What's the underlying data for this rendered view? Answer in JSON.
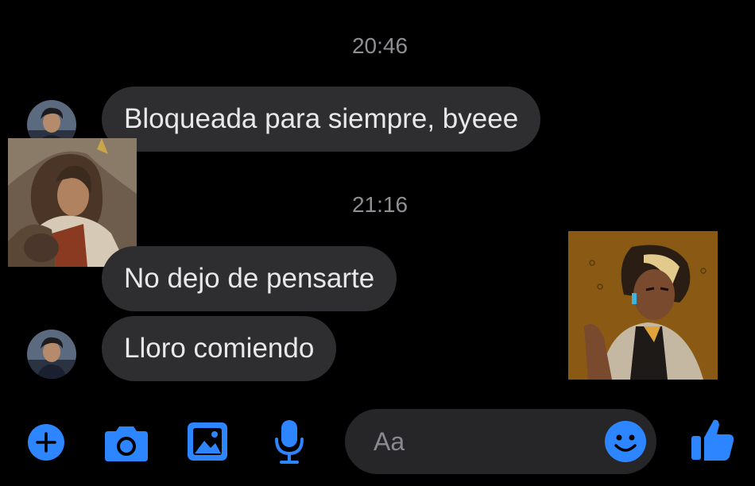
{
  "thread": {
    "timestamps": [
      "20:46",
      "21:16"
    ],
    "messages": [
      {
        "text": "Bloqueada para siempre, byeee"
      },
      {
        "text": "No dejo de pensarte"
      },
      {
        "text": "Lloro comiendo"
      }
    ]
  },
  "composer": {
    "placeholder": "Aa",
    "icons": [
      "plus-icon",
      "camera-icon",
      "image-icon",
      "microphone-icon",
      "emoji-icon",
      "thumbs-up-icon"
    ]
  },
  "colors": {
    "background": "#000000",
    "bubble": "#2e2e30",
    "accent": "#2d86ff",
    "timestamp": "#8e8e93"
  }
}
